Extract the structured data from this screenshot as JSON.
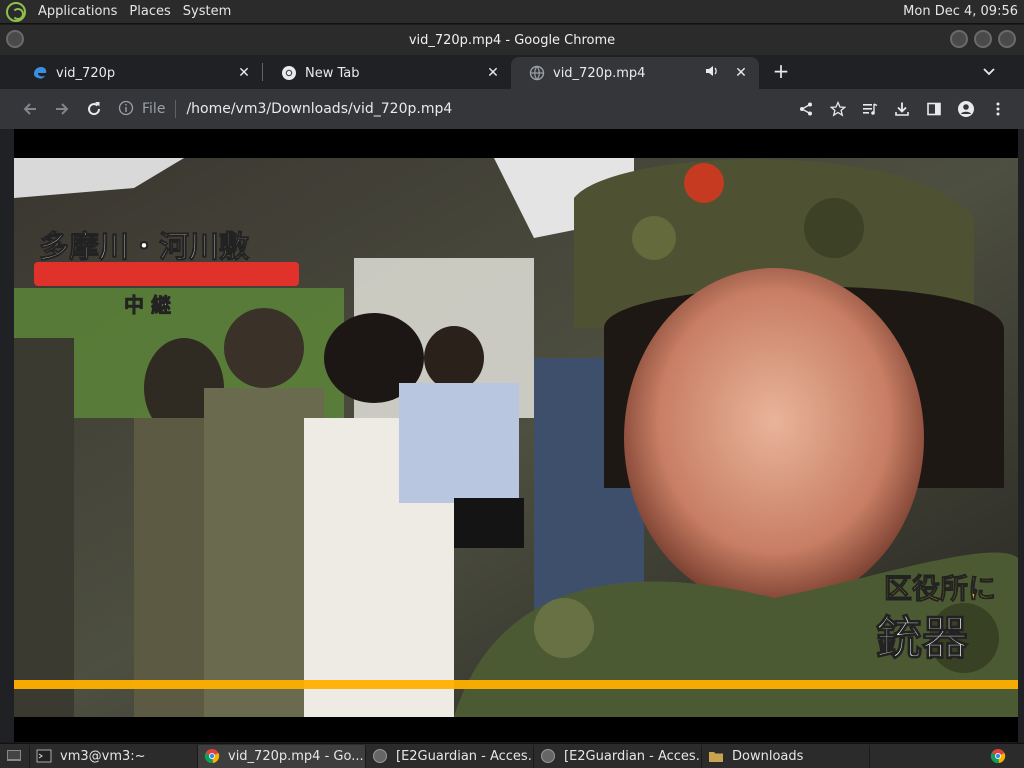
{
  "panel": {
    "menus": [
      "Applications",
      "Places",
      "System"
    ],
    "clock": "Mon Dec 4, 09:56"
  },
  "window": {
    "title": "vid_720p.mp4 - Google Chrome"
  },
  "tabs": [
    {
      "title": "vid_720p",
      "icon": "edge-icon"
    },
    {
      "title": "New Tab",
      "icon": "chrome-icon"
    },
    {
      "title": "vid_720p.mp4",
      "icon": "globe-icon",
      "audio": true
    }
  ],
  "address": {
    "scheme_label": "File",
    "url": "/home/vm3/Downloads/vid_720p.mp4"
  },
  "video": {
    "caption_top": "多摩川・河川敷",
    "caption_sub": "中 継",
    "caption_right_1": "区役所に",
    "caption_right_2": "銃器"
  },
  "taskbar": {
    "items": [
      {
        "label": "vm3@vm3:~",
        "icon": "terminal-icon"
      },
      {
        "label": "vid_720p.mp4 - Go...",
        "icon": "chrome-icon",
        "active": true
      },
      {
        "label": "[E2Guardian - Acces...",
        "icon": "globe-icon"
      },
      {
        "label": "[E2Guardian - Acces...",
        "icon": "globe-icon"
      },
      {
        "label": "Downloads",
        "icon": "folder-icon"
      }
    ]
  },
  "colors": {
    "accent_red": "#e0322a",
    "camo_green": "#5a6a3a"
  }
}
